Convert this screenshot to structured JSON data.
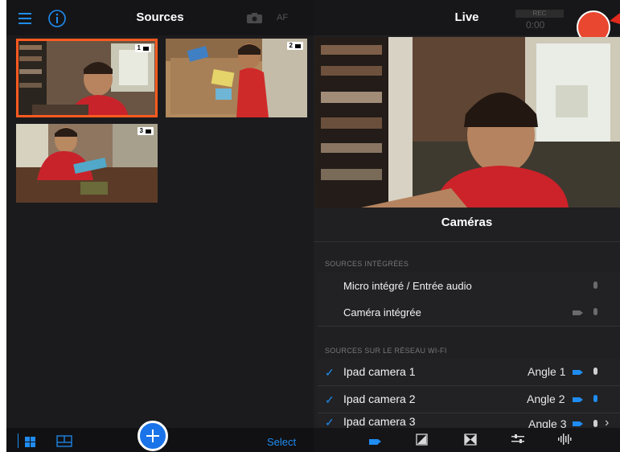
{
  "left": {
    "title": "Sources",
    "af_label": "AF",
    "icons": {
      "menu": "hamburger-icon",
      "info": "info-icon",
      "camera": "camera-icon"
    },
    "thumbnails": [
      {
        "number": "1",
        "selected": true
      },
      {
        "number": "2",
        "selected": false
      },
      {
        "number": "3",
        "selected": false
      }
    ],
    "bottom": {
      "select_label": "Select",
      "add_icon": "plus-icon",
      "grid_icon": "grid-icon",
      "layout_icon": "layout-icon"
    },
    "colors": {
      "selected_border": "#ff5a1f",
      "accent": "#1f8cf2"
    }
  },
  "right": {
    "title": "Live",
    "rec_label": "REC",
    "rec_time": "0:00",
    "cameras_title": "Caméras",
    "sections": [
      {
        "label": "SOURCES INTÉGRÉES",
        "rows": [
          {
            "label": "Micro intégré / Entrée audio"
          },
          {
            "label": "Caméra intégrée"
          }
        ]
      },
      {
        "label": "SOURCES SUR LE RÉSEAU WI-FI",
        "rows": [
          {
            "label": "Ipad camera 1",
            "angle": "Angle 1",
            "checked": true
          },
          {
            "label": "Ipad camera 2",
            "angle": "Angle 2",
            "checked": true
          },
          {
            "label": "Ipad camera 3",
            "angle": "Angle 3",
            "checked": true
          }
        ]
      }
    ],
    "checkmark": "✓",
    "chevron": "›",
    "toolbar_icons": [
      "video-camera-icon",
      "image-edit-icon",
      "transition-icon",
      "sliders-icon",
      "audio-wave-icon"
    ],
    "colors": {
      "record": "#e9472f",
      "accent": "#1f8cf2"
    }
  }
}
